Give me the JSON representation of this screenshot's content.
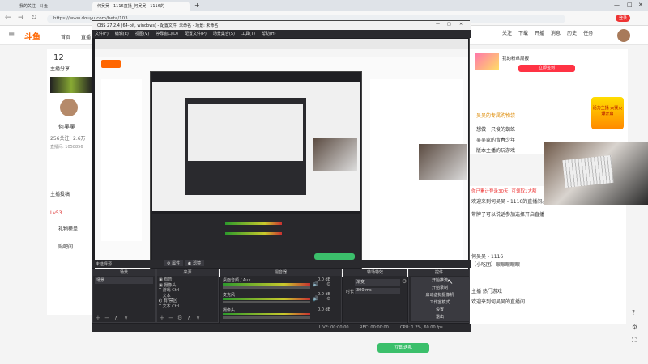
{
  "browser": {
    "tabs": [
      {
        "label": "我的关注 - 斗鱼"
      },
      {
        "label": "何吴吴 - 1116直播_何吴吴 - 1116的"
      }
    ],
    "url": "https://www.douyu.com/beta/103...",
    "profile_label": "登录"
  },
  "site": {
    "logo": "斗鱼",
    "nav": [
      "首页",
      "直播"
    ],
    "follow_count": "12",
    "follow_label": "主播分享",
    "streamer_name": "何吴吴",
    "fans": "256关注",
    "room_fans": "2.6万",
    "room_label": "直播间: 1058856",
    "menu_items": [
      "主播投稿",
      "礼物榜单",
      "贴吧间"
    ],
    "level": "Lv53",
    "right_tabs": [
      "关注",
      "下载",
      "开播",
      "消息",
      "历史",
      "任务"
    ],
    "right_title": "我的粉丝周报",
    "right_btn": "立即签到",
    "gift_title": "吴吴的专属购物袋",
    "ranks": [
      "吴吴的专属购物清单",
      "想做一只俊的蜘蛛",
      "吴吴家的青春少年",
      "版本主播的玩游戏"
    ],
    "chat_header": "你已累计登录30天! 可领取1大额",
    "chat_lines": [
      "欢迎来到何吴吴 - 1116的直播间。今日更新：",
      "带牌子可以说话参加选择开启直播",
      "何吴吴 - 1116",
      "【小吃团】眼眼眼眼眼",
      "主播 热门游戏",
      "欢迎来到何吴吴的直播间"
    ],
    "promo_badge": "活力主播 大赛火爆开启",
    "green_btn": "立即送礼"
  },
  "obs": {
    "title": "OBS 27.2.4 (64-bit, windows) - 配置文件: 未命名 - 场景: 未命名",
    "menu": [
      "文件(F)",
      "编辑(E)",
      "视图(V)",
      "停靠窗口(D)",
      "配置文件(P)",
      "场景集合(S)",
      "工具(T)",
      "帮助(H)"
    ],
    "selected_source": "未选择源",
    "props_btn": "属性",
    "filter_btn": "滤镜",
    "docks": {
      "scenes": {
        "title": "场景",
        "items": [
          "场景"
        ]
      },
      "sources": {
        "title": "来源",
        "items": [
          "有音",
          "摄像头",
          "游戏 Ctrl",
          "文本",
          "有/禁区",
          "文本 Ctrl",
          "文"
        ]
      },
      "mixer": {
        "title": "混音器",
        "channels": [
          {
            "name": "桌面音频 / Aux",
            "db": "0.0 dB"
          },
          {
            "name": "麦克风",
            "db": "0.0 dB"
          },
          {
            "name": "摄像头",
            "db": "0.0 dB"
          }
        ]
      },
      "transitions": {
        "title": "转场特效",
        "type": "渐变",
        "duration_label": "时长",
        "duration": "300 ms"
      },
      "controls": {
        "title": "控件",
        "buttons": [
          "开始推流",
          "开始录制",
          "启动虚拟摄像机",
          "工作室模式",
          "设置",
          "退出"
        ]
      }
    },
    "status": {
      "live": "LIVE: 00:00:00",
      "rec": "REC: 00:00:00",
      "cpu": "CPU: 1.2%, 60.00 fps"
    }
  }
}
